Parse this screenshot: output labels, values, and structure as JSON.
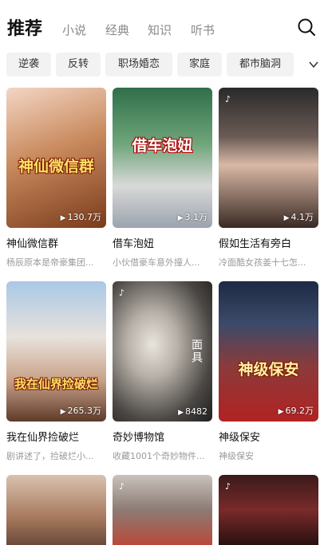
{
  "nav": {
    "tabs": [
      "推荐",
      "小说",
      "经典",
      "知识",
      "听书"
    ]
  },
  "chips": [
    "逆袭",
    "反转",
    "职场婚恋",
    "家庭",
    "都市脑洞"
  ],
  "cards": [
    {
      "title": "神仙微信群",
      "desc": "杨辰原本是帝豪集团...",
      "views": "130.7万",
      "poster_text": "神仙微信群",
      "tiktok": false
    },
    {
      "title": "借车泡妞",
      "desc": "小伙借豪车意外撞人...",
      "views": "3.1万",
      "poster_text": "借车泡妞",
      "tiktok": false
    },
    {
      "title": "假如生活有旁白",
      "desc": "冷面酷女孩姜十七怎...",
      "views": "4.1万",
      "poster_text": "",
      "tiktok": true
    },
    {
      "title": "我在仙界捡破烂",
      "desc": "剧讲述了，捡破烂小...",
      "views": "265.3万",
      "poster_text": "我在仙界捡破烂",
      "tiktok": false
    },
    {
      "title": "奇妙博物馆",
      "desc": "收藏1001个奇妙物件...",
      "views": "8482",
      "poster_text": "面具",
      "tiktok": true
    },
    {
      "title": "神级保安",
      "desc": "神级保安",
      "views": "69.2万",
      "poster_text": "神级保安",
      "tiktok": false
    },
    {
      "title": "",
      "desc": "",
      "views": "",
      "poster_text": "",
      "tiktok": false
    },
    {
      "title": "",
      "desc": "",
      "views": "",
      "poster_text": "",
      "tiktok": true
    },
    {
      "title": "",
      "desc": "",
      "views": "",
      "poster_text": "",
      "tiktok": true
    }
  ],
  "colors": {
    "active_tab": "#111111",
    "inactive_tab": "#8a8a8a",
    "chip_bg": "#f2f2f2"
  },
  "icons": [
    "search-icon",
    "chevron-down-icon",
    "play-icon",
    "tiktok-icon"
  ]
}
